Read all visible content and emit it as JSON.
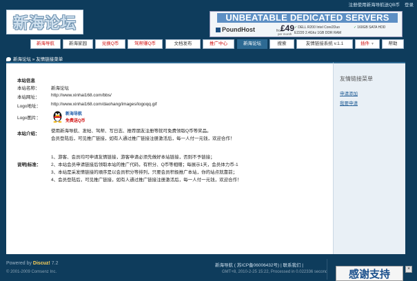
{
  "topbar": {
    "links": [
      "注册使用新海导航送QB币",
      "登录"
    ]
  },
  "header": {
    "logo_text": "新海论坛"
  },
  "ad": {
    "title": "UNBEATABLE DEDICATED SERVERS",
    "brand": "PoundHost",
    "from": "from",
    "price": "£49",
    "per_month": "per month",
    "specs": [
      "DELL R200 Intel Core2Duo",
      "160GB SATA HDD",
      "E2220 2.4Ghz 1GB DDR RAM"
    ]
  },
  "nav": {
    "items": [
      {
        "label": "新海导航",
        "style": "red"
      },
      {
        "label": "新海家园",
        "style": "normal"
      },
      {
        "label": "兑换Q币",
        "style": "red"
      },
      {
        "label": "驾帮赚Q币",
        "style": "red"
      },
      {
        "label": "文档发布",
        "style": "normal"
      },
      {
        "label": "推广中心",
        "style": "red"
      },
      {
        "label": "新海论坛",
        "style": "active"
      },
      {
        "label": "搜索",
        "style": "normal"
      },
      {
        "label": "友情链接系统 v.1.1",
        "style": "normal"
      },
      {
        "label": "插件",
        "style": "red"
      },
      {
        "label": "帮助",
        "style": "normal"
      }
    ]
  },
  "breadcrumb": {
    "text": "新海论坛  »  友情链接菜单"
  },
  "site_info": {
    "heading": "本站信息",
    "name_label": "本站名称：",
    "name_value": "新海论坛",
    "url_label": "本站网址：",
    "url_value": "http://www.xinhai168.com/bbs/",
    "logo_url_label": "Logo地址：",
    "logo_url_value": "http://www.xinhai168.com/daohang/images/logoqq.gif",
    "logo_img_label": "Logo图片：",
    "logo_img_line1": "新海导航",
    "logo_img_line2": "免费送Q币",
    "intro_label": "本站介绍：",
    "intro_line1": "使用新海导航、发帖、驾帮、写日志、推荐朋友注册等就可免费领取Q币等奖品。",
    "intro_line2": "会员登陆后，可见推广链接，如有人通过推广链接注册激活后，每一人付一元钱，欢迎合作！",
    "note_label": "说明|标准：",
    "notes": [
      "1、游客、会员均可申请友情链接，游客申请必须先做好本站链接，否则不予链接；",
      "2、本站会员申请链接后领取本站的推广代码，有积分、Q币等相赠；每展示1天，会员体力币-1",
      "3、本站是采发情链接的顺序是以会员积分等排列，只要会员积极推广本站，你的站点就靠前；",
      "4、会员登陆后，可见推广链接，如有人通过推广链接注册激活后，每一人付一元钱，欢迎合作！"
    ]
  },
  "sidebar": {
    "title": "友情链接菜单",
    "links": [
      "申请添加",
      "我要申请"
    ]
  },
  "footer": {
    "powered": "Powered by",
    "discuz": "Discuz!",
    "version": "7.2",
    "copyright": "© 2001-2009 Comsenz Inc.",
    "site_line": "新海导航 ( 苏ICP备06006432号) | 联系我们 |",
    "site_name": "新海导航",
    "time_line": "GMT+8, 2010-2-25 15:22, Processed in 0.022336 second"
  },
  "thanks_button": {
    "label": "感谢支持",
    "close": "×"
  },
  "colors": {
    "background": "#0e3c5c",
    "accent": "#2d6a93",
    "link": "#1f5b94",
    "red": "#d01010"
  }
}
